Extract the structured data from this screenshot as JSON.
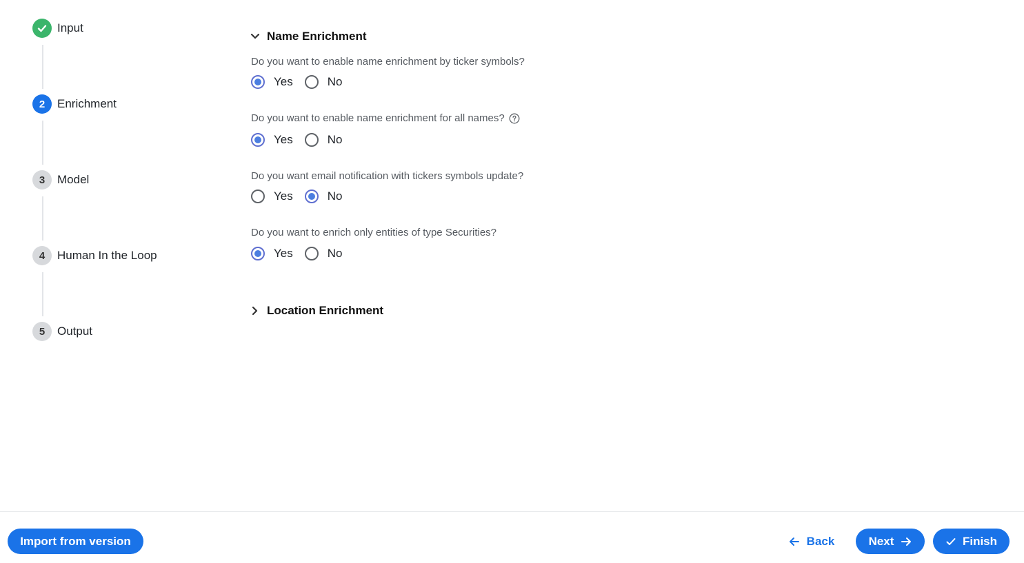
{
  "stepper": {
    "steps": [
      {
        "number": "",
        "label": "Input",
        "state": "done"
      },
      {
        "number": "2",
        "label": "Enrichment",
        "state": "active"
      },
      {
        "number": "3",
        "label": "Model",
        "state": "pending"
      },
      {
        "number": "4",
        "label": "Human In the Loop",
        "state": "pending"
      },
      {
        "number": "5",
        "label": "Output",
        "state": "pending"
      }
    ]
  },
  "sections": {
    "name_enrichment": {
      "title": "Name Enrichment",
      "expanded": true,
      "questions": [
        {
          "text": "Do you want to enable name enrichment by ticker symbols?",
          "yes_label": "Yes",
          "no_label": "No",
          "selected": "Yes"
        },
        {
          "text": "Do you want to enable name enrichment for all names?",
          "yes_label": "Yes",
          "no_label": "No",
          "selected": "Yes",
          "help_icon": "question-circle-icon"
        },
        {
          "text": "Do you want email notification with tickers symbols update?",
          "yes_label": "Yes",
          "no_label": "No",
          "selected": "No"
        },
        {
          "text": "Do you want to enrich only entities of type Securities?",
          "yes_label": "Yes",
          "no_label": "No",
          "selected": "Yes"
        }
      ]
    },
    "location_enrichment": {
      "title": "Location Enrichment",
      "expanded": false
    }
  },
  "footer": {
    "import_label": "Import from version",
    "back_label": "Back",
    "next_label": "Next",
    "finish_label": "Finish"
  },
  "colors": {
    "primary": "#1a73e8",
    "success": "#3bb56b",
    "radio_checked": "#4c7ee0"
  }
}
